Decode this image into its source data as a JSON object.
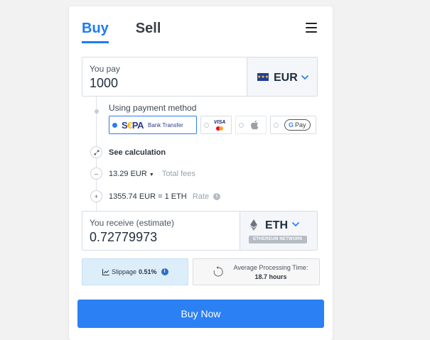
{
  "tabs": [
    {
      "label": "Buy",
      "active": true
    },
    {
      "label": "Sell",
      "active": false
    }
  ],
  "menu_icon": "hamburger-menu-icon",
  "pay": {
    "label": "You pay",
    "value": "1000",
    "currency": "EUR",
    "flag_icon": "eu-flag-icon"
  },
  "payment_method": {
    "label": "Using payment method",
    "options": [
      {
        "name": "SEPA",
        "text": "Bank Transfer",
        "selected": true
      },
      {
        "name": "Visa/Mastercard",
        "visa_text": "VISA",
        "selected": false
      },
      {
        "name": "Apple Pay",
        "icon": "apple-icon",
        "selected": false
      },
      {
        "name": "Google Pay",
        "g": "G",
        "text": "Pay",
        "selected": false
      }
    ]
  },
  "see_calculation": "See calculation",
  "fees": {
    "amount": "13.29 EUR",
    "label": "Total fees"
  },
  "rate": {
    "value": "1355.74 EUR = 1 ETH",
    "label": "Rate"
  },
  "receive": {
    "label": "You receive (estimate)",
    "value": "0.72779973",
    "currency": "ETH",
    "network": "ETHEREUM NETWORK"
  },
  "slippage": {
    "label": "Slippage",
    "value": "0.51%"
  },
  "processing": {
    "label": "Average Processing Time:",
    "value": "18.7 hours"
  },
  "buy_button": "Buy Now",
  "colors": {
    "accent": "#2b80f4",
    "tab_active": "#1e7bf5",
    "background": "#f2f2f2"
  }
}
